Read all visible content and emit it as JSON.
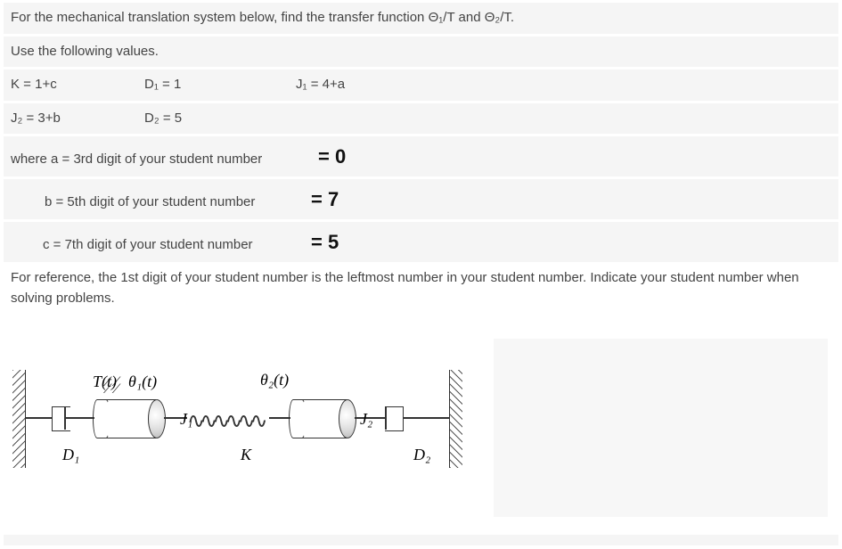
{
  "line_intro": "For the mechanical translation system below, find the transfer function Θ₁/T and Θ₂/T.",
  "line_use": "Use the following values.",
  "params_row1": {
    "k": "K = 1+c",
    "d1": "D₁ = 1",
    "j1": "J₁ = 4+a"
  },
  "params_row2": {
    "j2": "J₂ = 3+b",
    "d2": "D₂ = 5"
  },
  "where_a": {
    "text": "where a = 3rd digit of your student number",
    "val": "= 0"
  },
  "where_b": {
    "text": "b = 5th digit of your student number",
    "val": "= 7"
  },
  "where_c": {
    "text": "c = 7th digit of your student number",
    "val": "= 5"
  },
  "reference": "For reference, the 1st digit of your student number is the leftmost number in your student number. Indicate your student number when solving problems.",
  "figure": {
    "Tt": "T(t)",
    "theta1": "θ₁(t)",
    "theta2": "θ₂(t)",
    "J1": "J₁",
    "J2": "J₂",
    "D1": "D₁",
    "D2": "D₂",
    "K": "K"
  }
}
